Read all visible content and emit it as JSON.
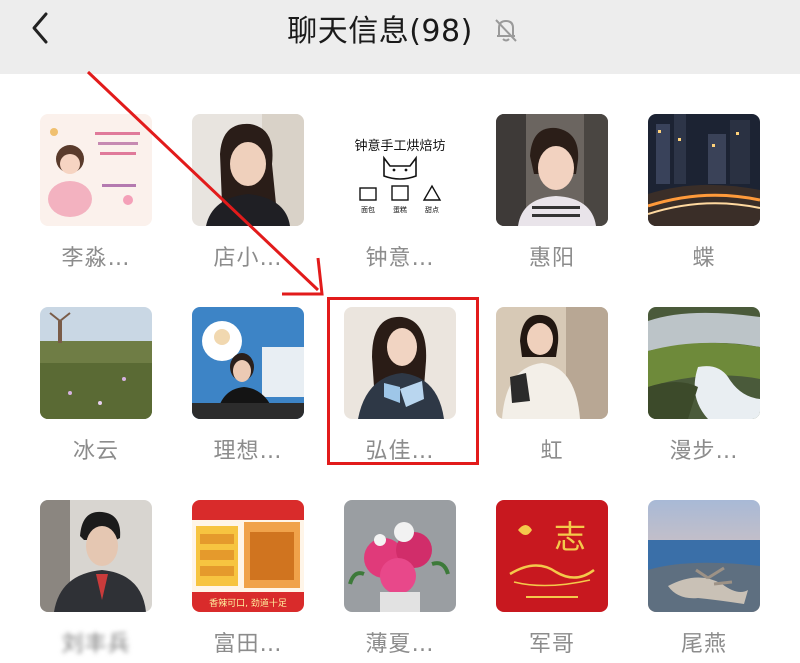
{
  "header": {
    "title": "聊天信息(98)",
    "back_icon": "chevron-left-icon",
    "mute_icon": "bell-off-icon"
  },
  "members": [
    {
      "name": "李淼…",
      "avatar": "cartoon-girl-avatar"
    },
    {
      "name": "店小…",
      "avatar": "woman-photo-avatar"
    },
    {
      "name": "钟意…",
      "avatar": "bakery-logo-avatar",
      "avatar_text": "钟意手工烘焙坊",
      "avatar_items": [
        "面包",
        "蛋糕",
        "甜点"
      ]
    },
    {
      "name": "惠阳",
      "avatar": "woman-selfie-avatar"
    },
    {
      "name": "蝶",
      "avatar": "city-night-avatar"
    },
    {
      "name": "冰云",
      "avatar": "meadow-windmill-avatar"
    },
    {
      "name": "理想…",
      "avatar": "woman-at-table-avatar"
    },
    {
      "name": "弘佳…",
      "avatar": "woman-portrait-avatar",
      "highlighted": true
    },
    {
      "name": "虹",
      "avatar": "woman-sofa-avatar"
    },
    {
      "name": "漫步…",
      "avatar": "mossy-rocks-avatar"
    },
    {
      "name": "刘丰兵",
      "avatar": "man-suit-avatar",
      "blurred": true
    },
    {
      "name": "富田…",
      "avatar": "snack-package-avatar",
      "avatar_caption": "香辣可口, 劲道十足"
    },
    {
      "name": "薄夏…",
      "avatar": "peony-flowers-avatar"
    },
    {
      "name": "军哥",
      "avatar": "red-calligraphy-avatar",
      "avatar_text": "志"
    },
    {
      "name": "尾燕",
      "avatar": "lake-tree-avatar"
    }
  ],
  "annotation": {
    "color": "#e21b1b",
    "target": "弘佳…"
  }
}
